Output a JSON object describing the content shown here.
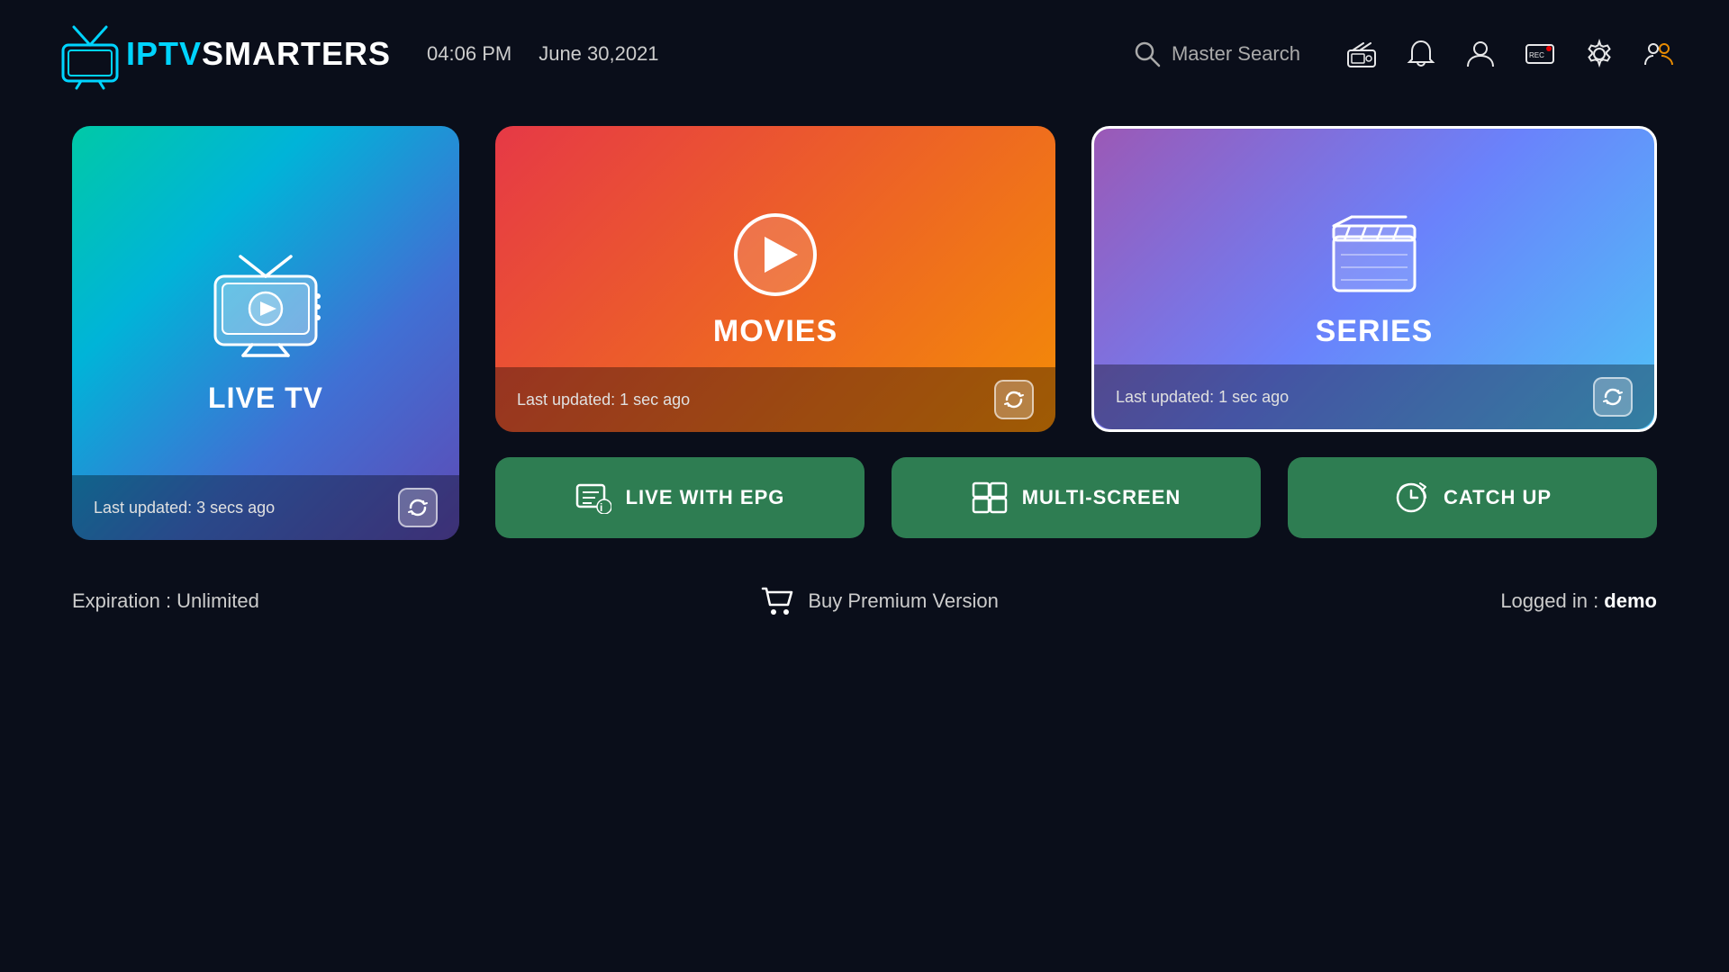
{
  "header": {
    "logo_iptv": "IPTV",
    "logo_smarters": "SMARTERS",
    "time": "04:06 PM",
    "date": "June 30,2021",
    "search_placeholder": "Master Search",
    "icons": {
      "radio": "radio-icon",
      "bell": "bell-icon",
      "user": "user-icon",
      "record": "record-icon",
      "settings": "settings-icon",
      "switch_user": "switch-user-icon"
    }
  },
  "cards": {
    "live_tv": {
      "title": "LIVE TV",
      "last_updated": "Last updated: 3 secs ago"
    },
    "movies": {
      "title": "MOVIES",
      "last_updated": "Last updated: 1 sec ago"
    },
    "series": {
      "title": "SERIES",
      "last_updated": "Last updated: 1 sec ago"
    }
  },
  "buttons": {
    "live_epg": "LIVE WITH EPG",
    "multi_screen": "MULTI-SCREEN",
    "catch_up": "CATCH UP"
  },
  "footer": {
    "expiration_label": "Expiration : ",
    "expiration_value": "Unlimited",
    "buy_premium": "Buy Premium Version",
    "logged_in_label": "Logged in : ",
    "logged_in_user": "demo"
  }
}
